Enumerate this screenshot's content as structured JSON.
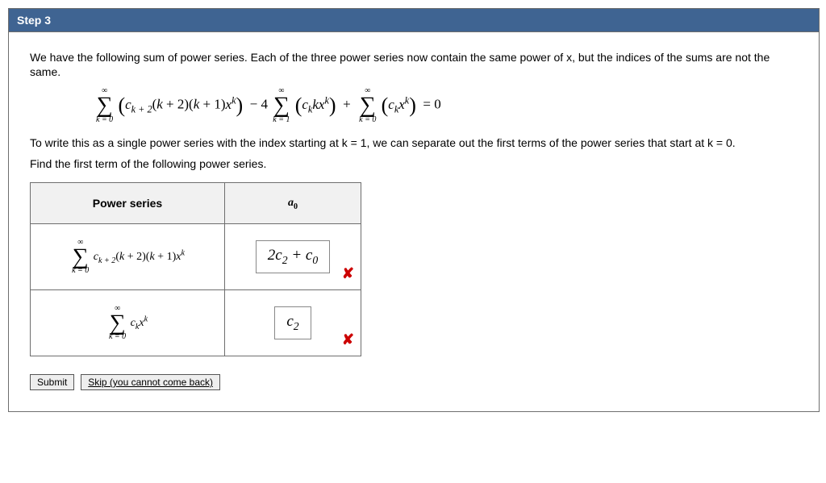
{
  "step": {
    "label": "Step 3"
  },
  "text": {
    "intro": "We have the following sum of power series. Each of the three power series now contain the same power of x, but the indices of the sums are not the same.",
    "explain": "To write this as a single power series with the index starting at k = 1, we can separate out the first terms of the power series that start at k = 0.",
    "find": "Find the first term of the following power series."
  },
  "table": {
    "headers": {
      "series": "Power series",
      "a0_letter": "a",
      "a0_sub": "0"
    },
    "rows": [
      {
        "answer_main": "2c",
        "answer_sub1": "2",
        "answer_mid": " + c",
        "answer_sub2": "0"
      },
      {
        "answer_main": "c",
        "answer_sub1": "2",
        "answer_mid": "",
        "answer_sub2": ""
      }
    ]
  },
  "buttons": {
    "submit": "Submit",
    "skip": "Skip (you cannot come back)"
  },
  "icons": {
    "wrong": "✘"
  }
}
